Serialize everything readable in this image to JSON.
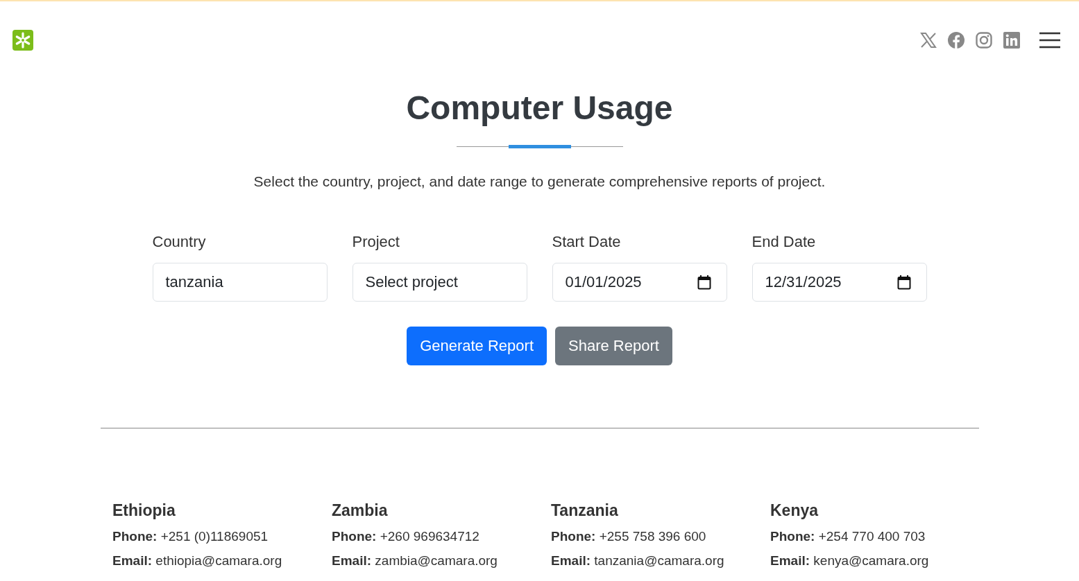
{
  "header": {
    "social_links": [
      {
        "kind": "x"
      },
      {
        "kind": "facebook"
      },
      {
        "kind": "instagram"
      },
      {
        "kind": "linkedin"
      }
    ]
  },
  "title": "Computer Usage",
  "subtitle": "Select the country, project, and date range to generate comprehensive reports of project.",
  "fields": [
    {
      "label": "Country",
      "value": "tanzania",
      "kind": "text"
    },
    {
      "label": "Project",
      "value": "Select project",
      "kind": "select"
    },
    {
      "label": "Start Date",
      "value": "01/01/2025",
      "kind": "date"
    },
    {
      "label": "End Date",
      "value": "12/31/2025",
      "kind": "date"
    }
  ],
  "buttons": [
    {
      "label": "Generate Report",
      "kind": "primary"
    },
    {
      "label": "Share Report",
      "kind": "secondary"
    }
  ],
  "footer": {
    "offices": [
      {
        "country": "Ethiopia",
        "phone": "**Phone:** +251 (0)11869051",
        "email": "**Email:** ethiopia@camara.org"
      },
      {
        "country": "Zambia",
        "phone": "**Phone:** +260 969634712",
        "email": "**Email:** zambia@camara.org"
      },
      {
        "country": "Tanzania",
        "phone": "**Phone:** +255 758 396 600",
        "email": "**Email:** tanzania@camara.org"
      },
      {
        "country": "Kenya",
        "phone": "**Phone:** +254 770 400 703",
        "email": "**Email:** kenya@camara.org"
      }
    ]
  }
}
